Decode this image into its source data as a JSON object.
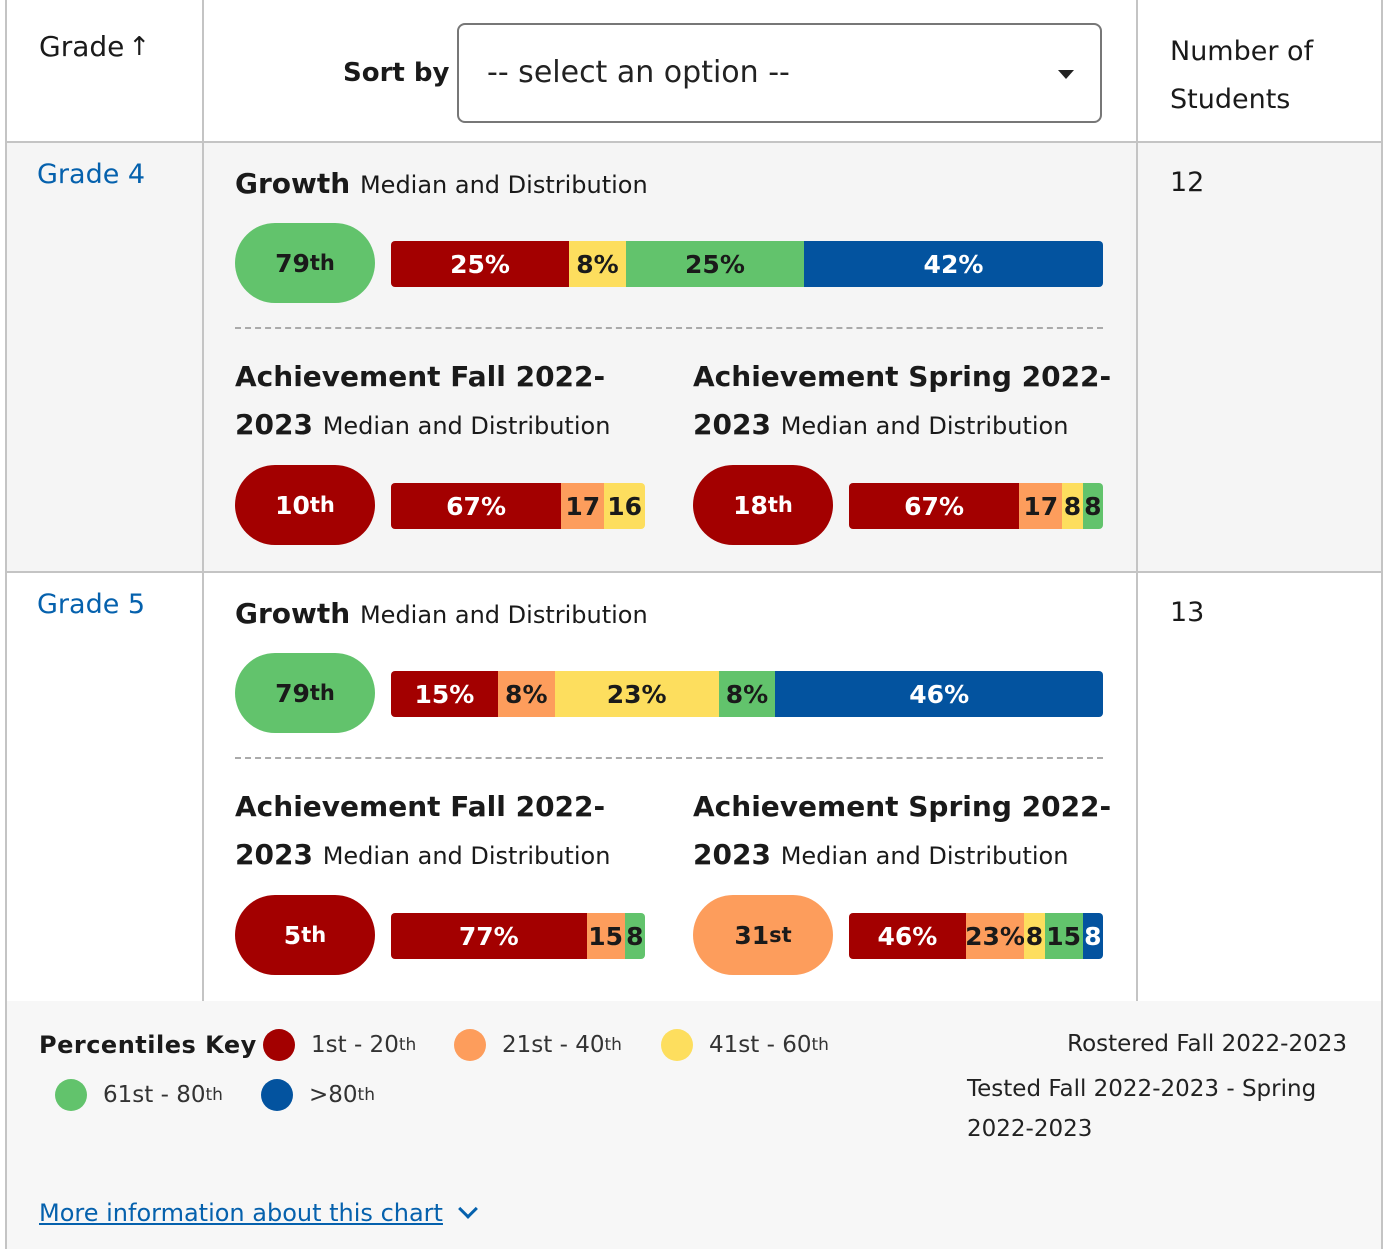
{
  "header": {
    "grade_label": "Grade",
    "sort_arrow": "↑",
    "sort_by_label": "Sort by",
    "sort_select": {
      "value": "-- select an option --"
    },
    "students_label_line1": "Number of",
    "students_label_line2": "Students"
  },
  "colors": {
    "p1_20": "#a30000",
    "p21_40": "#fd9d5c",
    "p41_60": "#fdde5e",
    "p61_80": "#62c36c",
    "p80_plus": "#03539f",
    "link": "#0561ad"
  },
  "rows": [
    {
      "grade": "Grade 4",
      "students": "12",
      "growth": {
        "title": "Growth",
        "subtitle": "Median and Distribution",
        "median_num": "79",
        "median_suffix": "th",
        "median_band": "61-80",
        "segments": [
          {
            "band": "1-20",
            "pct": 25,
            "label": "25%"
          },
          {
            "band": "41-60",
            "pct": 8,
            "label": "8%"
          },
          {
            "band": "61-80",
            "pct": 25,
            "label": "25%"
          },
          {
            "band": "80+",
            "pct": 42,
            "label": "42%"
          }
        ]
      },
      "fall": {
        "title": "Achievement Fall 2022-2023",
        "subtitle": "Median and Distribution",
        "median_num": "10",
        "median_suffix": "th",
        "median_band": "1-20",
        "segments": [
          {
            "band": "1-20",
            "pct": 67,
            "label": "67%"
          },
          {
            "band": "21-40",
            "pct": 17,
            "label": "17"
          },
          {
            "band": "41-60",
            "pct": 16,
            "label": "16"
          }
        ]
      },
      "spring": {
        "title": "Achievement Spring 2022-2023",
        "subtitle": "Median and Distribution",
        "median_num": "18",
        "median_suffix": "th",
        "median_band": "1-20",
        "segments": [
          {
            "band": "1-20",
            "pct": 67,
            "label": "67%"
          },
          {
            "band": "21-40",
            "pct": 17,
            "label": "17"
          },
          {
            "band": "41-60",
            "pct": 8,
            "label": "8"
          },
          {
            "band": "61-80",
            "pct": 8,
            "label": "8"
          }
        ]
      }
    },
    {
      "grade": "Grade 5",
      "students": "13",
      "growth": {
        "title": "Growth",
        "subtitle": "Median and Distribution",
        "median_num": "79",
        "median_suffix": "th",
        "median_band": "61-80",
        "segments": [
          {
            "band": "1-20",
            "pct": 15,
            "label": "15%"
          },
          {
            "band": "21-40",
            "pct": 8,
            "label": "8%"
          },
          {
            "band": "41-60",
            "pct": 23,
            "label": "23%"
          },
          {
            "band": "61-80",
            "pct": 8,
            "label": "8%"
          },
          {
            "band": "80+",
            "pct": 46,
            "label": "46%"
          }
        ]
      },
      "fall": {
        "title": "Achievement Fall 2022-2023",
        "subtitle": "Median and Distribution",
        "median_num": "5",
        "median_suffix": "th",
        "median_band": "1-20",
        "segments": [
          {
            "band": "1-20",
            "pct": 77,
            "label": "77%"
          },
          {
            "band": "21-40",
            "pct": 15,
            "label": "15"
          },
          {
            "band": "61-80",
            "pct": 8,
            "label": "8"
          }
        ]
      },
      "spring": {
        "title": "Achievement Spring 2022-2023",
        "subtitle": "Median and Distribution",
        "median_num": "31",
        "median_suffix": "st",
        "median_band": "21-40",
        "segments": [
          {
            "band": "1-20",
            "pct": 46,
            "label": "46%"
          },
          {
            "band": "21-40",
            "pct": 23,
            "label": "23%"
          },
          {
            "band": "41-60",
            "pct": 8,
            "label": "8"
          },
          {
            "band": "61-80",
            "pct": 15,
            "label": "15"
          },
          {
            "band": "80+",
            "pct": 8,
            "label": "8"
          }
        ]
      }
    }
  ],
  "footer": {
    "key_title": "Percentiles Key",
    "key_items": [
      {
        "band": "1-20",
        "text": "1st - 20",
        "sup": "th"
      },
      {
        "band": "21-40",
        "text": "21st - 40",
        "sup": "th"
      },
      {
        "band": "41-60",
        "text": "41st - 60",
        "sup": "th"
      },
      {
        "band": "61-80",
        "text": "61st - 80",
        "sup": "th"
      },
      {
        "band": "80+",
        "text": ">80",
        "sup": "th"
      }
    ],
    "rostered": "Rostered Fall 2022-2023",
    "tested": "Tested Fall 2022-2023 - Spring 2022-2023",
    "more_info": "More information about this chart"
  }
}
